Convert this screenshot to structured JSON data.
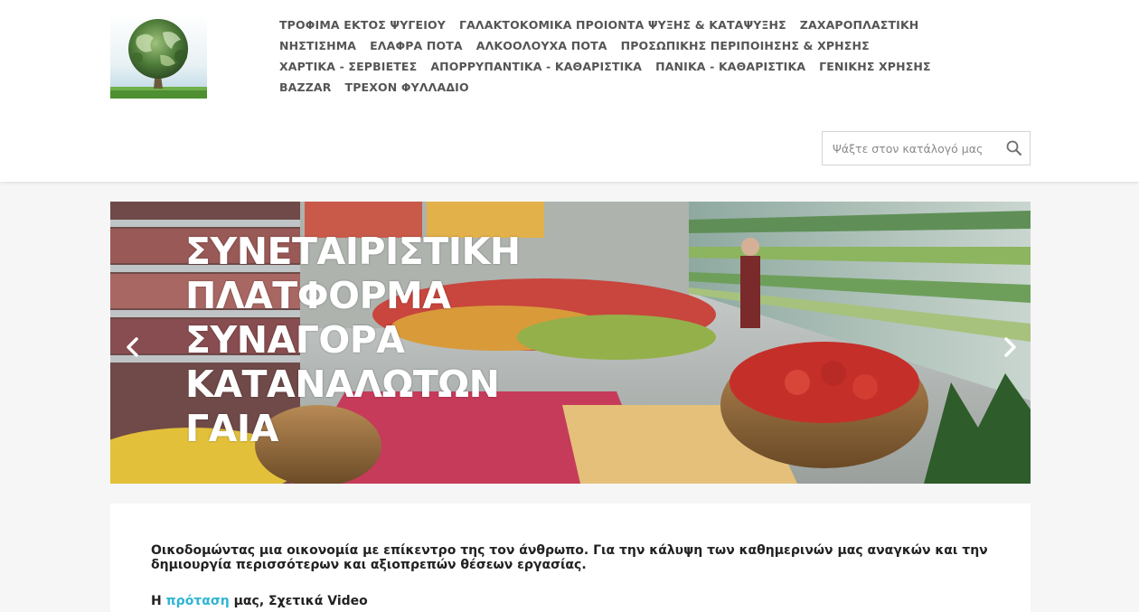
{
  "header": {
    "logo_alt": "logo",
    "menu_rows": [
      [
        "ΤΡΟΦΙΜΑ ΕΚΤΟΣ ΨΥΓΕΙΟΥ",
        "ΓΑΛΑΚΤΟΚΟΜΙΚΑ ΠΡΟΙΟΝΤΑ ΨΥΞΗΣ & ΚΑΤΑΨΥΞΗΣ",
        "ΖΑΧΑΡΟΠΛΑΣΤΙΚΗ"
      ],
      [
        "ΝΗΣΤΙΣΗΜΑ",
        "ΕΛΑΦΡΑ ΠΟΤΑ",
        "ΑΛΚΟΟΛΟΥΧΑ ΠΟΤΑ",
        "ΠΡΟΣΩΠΙΚΗΣ ΠΕΡΙΠΟΙΗΣΗΣ & ΧΡΗΣΗΣ"
      ],
      [
        "ΧΑΡΤΙΚΑ - ΣΕΡΒΙΕΤΕΣ",
        "ΑΠΟΡΡΥΠΑΝΤΙΚΑ - ΚΑΘΑΡΙΣΤΙΚΑ",
        "ΠΑΝΙΚΑ - ΚΑΘΑΡΙΣΤΙΚΑ",
        "ΓΕΝΙΚΗΣ ΧΡΗΣΗΣ"
      ],
      [
        "BAZZAR",
        "ΤΡΕΧΟΝ ΦΥΛΛΑΔΙΟ"
      ]
    ],
    "search": {
      "placeholder": "Ψάξτε στον κατάλογό μας",
      "icon": "search-icon"
    }
  },
  "slider": {
    "title_lines": [
      "ΣΥΝΕΤΑΙΡΙΣΤΙΚΗ",
      "ΠΛΑΤΦΟΡΜΑ",
      "ΣΥΝΑΓΟΡΑ",
      "ΚΑΤΑΝΑΛΩΤΩΝ",
      "ΓΑΙΑ"
    ],
    "prev_icon": "chevron-left-icon",
    "next_icon": "chevron-right-icon"
  },
  "content": {
    "intro": "Οικοδομώντας μια οικονομία με επίκεντρο της τον άνθρωπο. Για την κάλυψη των καθημερινών μας αναγκών και την δημιουργία περισσότερων και αξιοπρεπών θέσεων εργασίας.",
    "more_prefix": "Η ",
    "more_link": "πρόταση",
    "more_suffix": " μας, Σχετικά Video"
  },
  "colors": {
    "link": "#2fb5d2",
    "menu_text": "#555555",
    "page_bg": "#f6f6f6"
  }
}
